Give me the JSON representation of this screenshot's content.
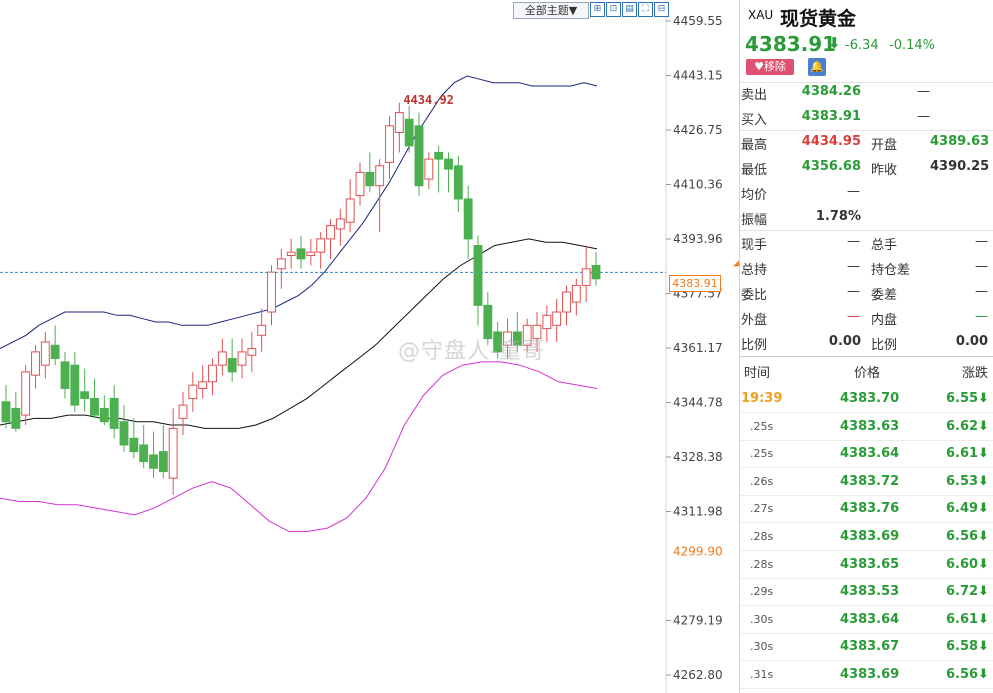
{
  "toolbar": {
    "theme_label": "全部主题▼"
  },
  "watermark": "@守盘人-童哥",
  "current_price_tag": "4383.91",
  "chart_data": {
    "type": "candlestick",
    "y_ticks": [
      4459.55,
      4443.15,
      4426.75,
      4410.36,
      4393.96,
      4377.57,
      4361.17,
      4344.78,
      4328.38,
      4311.98,
      4279.19,
      4262.8
    ],
    "y_tick_labels": [
      "4459.55",
      "4443.15",
      "4426.75",
      "4410.36",
      "4393.96",
      "4377.57",
      "4361.17",
      "4344.78",
      "4328.38",
      "4311.98",
      "4279.19",
      "4262.80"
    ],
    "highlight_tick": "4299.90",
    "ylim": [
      4262.8,
      4459.55
    ],
    "high_annotation": "4434.92",
    "current_price": 4383.91,
    "colors": {
      "up": "#e05252",
      "down": "#4caf50",
      "upper_band": "#1a237e",
      "mid_band": "#111111",
      "lower_band": "#d633d6",
      "price_line": "#2e8bc9"
    },
    "candles": [
      [
        4345,
        4350,
        4337,
        4339
      ],
      [
        4343,
        4348,
        4336,
        4337
      ],
      [
        4341,
        4356,
        4338,
        4354
      ],
      [
        4353,
        4362,
        4349,
        4360
      ],
      [
        4356,
        4366,
        4352,
        4363
      ],
      [
        4362,
        4368,
        4356,
        4358
      ],
      [
        4357,
        4360,
        4346,
        4349
      ],
      [
        4356,
        4360,
        4342,
        4344
      ],
      [
        4348,
        4355,
        4342,
        4346
      ],
      [
        4346,
        4352,
        4340,
        4341
      ],
      [
        4343,
        4347,
        4338,
        4339
      ],
      [
        4346,
        4350,
        4334,
        4337
      ],
      [
        4339,
        4344,
        4330,
        4332
      ],
      [
        4334,
        4340,
        4328,
        4330
      ],
      [
        4332,
        4338,
        4325,
        4327
      ],
      [
        4329,
        4336,
        4322,
        4325
      ],
      [
        4330,
        4338,
        4322,
        4324
      ],
      [
        4322,
        4343,
        4317,
        4337
      ],
      [
        4340,
        4348,
        4335,
        4344
      ],
      [
        4346,
        4354,
        4342,
        4350
      ],
      [
        4349,
        4356,
        4346,
        4351
      ],
      [
        4351,
        4358,
        4347,
        4356
      ],
      [
        4356,
        4364,
        4353,
        4360
      ],
      [
        4358,
        4364,
        4351,
        4354
      ],
      [
        4356,
        4364,
        4352,
        4360
      ],
      [
        4359,
        4366,
        4354,
        4361
      ],
      [
        4365,
        4373,
        4360,
        4368
      ],
      [
        4372,
        4386,
        4368,
        4384
      ],
      [
        4385,
        4391,
        4379,
        4388
      ],
      [
        4389,
        4394,
        4385,
        4390
      ],
      [
        4391,
        4395,
        4385,
        4388
      ],
      [
        4389,
        4394,
        4386,
        4390
      ],
      [
        4390,
        4396,
        4385,
        4394
      ],
      [
        4394,
        4400,
        4388,
        4398
      ],
      [
        4397,
        4403,
        4392,
        4400
      ],
      [
        4399,
        4412,
        4396,
        4406
      ],
      [
        4407,
        4417,
        4404,
        4414
      ],
      [
        4414,
        4420,
        4408,
        4410
      ],
      [
        4410,
        4418,
        4396,
        4416
      ],
      [
        4417,
        4431,
        4412,
        4428
      ],
      [
        4426,
        4435,
        4420,
        4432
      ],
      [
        4430,
        4434,
        4420,
        4422
      ],
      [
        4428,
        4432,
        4407,
        4410
      ],
      [
        4412,
        4420,
        4409,
        4418
      ],
      [
        4420,
        4422,
        4408,
        4418
      ],
      [
        4418,
        4420,
        4408,
        4415
      ],
      [
        4416,
        4419,
        4402,
        4406
      ],
      [
        4406,
        4410,
        4388,
        4394
      ],
      [
        4392,
        4395,
        4368,
        4374
      ],
      [
        4374,
        4378,
        4362,
        4364
      ],
      [
        4366,
        4369,
        4358,
        4360
      ],
      [
        4362,
        4370,
        4358,
        4366
      ],
      [
        4366,
        4372,
        4360,
        4362
      ],
      [
        4362,
        4370,
        4360,
        4368
      ],
      [
        4364,
        4372,
        4360,
        4368
      ],
      [
        4367,
        4374,
        4363,
        4371
      ],
      [
        4368,
        4376,
        4363,
        4372
      ],
      [
        4372,
        4380,
        4368,
        4378
      ],
      [
        4375,
        4382,
        4371,
        4380
      ],
      [
        4380,
        4392,
        4375,
        4385
      ],
      [
        4386,
        4390,
        4380,
        4382
      ]
    ],
    "upper_band": [
      4361,
      4363,
      4365,
      4368,
      4370,
      4372,
      4372,
      4372,
      4372,
      4371,
      4371,
      4370,
      4369,
      4369,
      4368,
      4368,
      4368,
      4369,
      4370,
      4371,
      4372,
      4373,
      4375,
      4377,
      4380,
      4384,
      4389,
      4394,
      4399,
      4405,
      4411,
      4418,
      4425,
      4431,
      4437,
      4441,
      4443,
      4442,
      4441,
      4441,
      4441,
      4440,
      4440,
      4440,
      4440,
      4441,
      4440
    ],
    "mid_band": [
      4338,
      4339,
      4340,
      4340,
      4341,
      4341,
      4340,
      4340,
      4339,
      4339,
      4338,
      4338,
      4337,
      4337,
      4337,
      4338,
      4340,
      4343,
      4346,
      4350,
      4354,
      4358,
      4362,
      4367,
      4372,
      4377,
      4382,
      4386,
      4389,
      4392,
      4393,
      4394,
      4393,
      4393,
      4392,
      4391
    ],
    "lower_band": [
      4316,
      4315,
      4315,
      4314,
      4314,
      4313,
      4312,
      4311,
      4313,
      4316,
      4319,
      4321,
      4319,
      4314,
      4309,
      4306,
      4306,
      4307,
      4310,
      4316,
      4325,
      4338,
      4347,
      4353,
      4356,
      4357,
      4357,
      4356,
      4354,
      4351,
      4350,
      4349
    ]
  },
  "quote": {
    "symbol": "XAU",
    "name": "现货黄金",
    "price": "4383.91",
    "change": "-6.34",
    "change_pct": "-0.14%",
    "remove_label": "移除",
    "sell_label": "卖出",
    "sell_value": "4384.26",
    "sell_extra": "—",
    "buy_label": "买入",
    "buy_value": "4383.91",
    "buy_extra": "—",
    "high_label": "最高",
    "high_value": "4434.95",
    "open_label": "开盘",
    "open_value": "4389.63",
    "low_label": "最低",
    "low_value": "4356.68",
    "prev_label": "昨收",
    "prev_value": "4390.25",
    "avg_label": "均价",
    "avg_value": "—",
    "amp_label": "振幅",
    "amp_value": "1.78%",
    "now_vol_label": "现手",
    "now_vol_value": "—",
    "total_vol_label": "总手",
    "total_vol_value": "—",
    "total_hold_label": "总持",
    "total_hold_value": "—",
    "hold_diff_label": "持仓差",
    "hold_diff_value": "—",
    "commit_ratio_label": "委比",
    "commit_ratio_value": "—",
    "commit_diff_label": "委差",
    "commit_diff_value": "—",
    "outer_label": "外盘",
    "outer_value": "—",
    "inner_label": "内盘",
    "inner_value": "—",
    "ratio1_label": "比例",
    "ratio1_value": "0.00",
    "ratio2_label": "比例",
    "ratio2_value": "0.00"
  },
  "ticks": {
    "head_time": "时间",
    "head_price": "价格",
    "head_change": "涨跌",
    "rows": [
      {
        "time": "19:39",
        "price": "4383.70",
        "change": "6.55"
      },
      {
        "time": ".25s",
        "price": "4383.63",
        "change": "6.62"
      },
      {
        "time": ".25s",
        "price": "4383.64",
        "change": "6.61"
      },
      {
        "time": ".26s",
        "price": "4383.72",
        "change": "6.53"
      },
      {
        "time": ".27s",
        "price": "4383.76",
        "change": "6.49"
      },
      {
        "time": ".28s",
        "price": "4383.69",
        "change": "6.56"
      },
      {
        "time": ".28s",
        "price": "4383.65",
        "change": "6.60"
      },
      {
        "time": ".29s",
        "price": "4383.53",
        "change": "6.72"
      },
      {
        "time": ".30s",
        "price": "4383.64",
        "change": "6.61"
      },
      {
        "time": ".30s",
        "price": "4383.67",
        "change": "6.58"
      },
      {
        "time": ".31s",
        "price": "4383.69",
        "change": "6.56"
      }
    ]
  }
}
